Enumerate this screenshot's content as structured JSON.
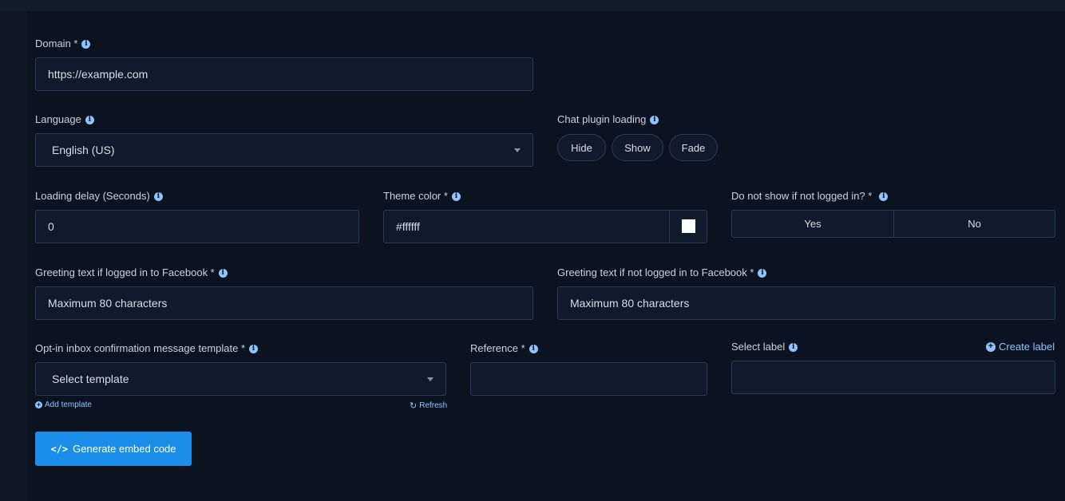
{
  "domain": {
    "label": "Domain *",
    "value": "https://example.com"
  },
  "language": {
    "label": "Language",
    "selected": "English (US)"
  },
  "chat_plugin": {
    "label": "Chat plugin loading",
    "options": [
      "Hide",
      "Show",
      "Fade"
    ]
  },
  "loading_delay": {
    "label": "Loading delay (Seconds)",
    "value": "0"
  },
  "theme_color": {
    "label": "Theme color *",
    "value": "#ffffff",
    "swatch_color": "#ffffff"
  },
  "not_logged": {
    "label": "Do not show if not logged in? *",
    "yes": "Yes",
    "no": "No"
  },
  "greeting_logged": {
    "label": "Greeting text if logged in to Facebook *",
    "placeholder": "Maximum 80 characters"
  },
  "greeting_not_logged": {
    "label": "Greeting text if not logged in to Facebook *",
    "placeholder": "Maximum 80 characters"
  },
  "optin": {
    "label": "Opt-in inbox confirmation message template *",
    "selected": "Select template",
    "add_template": "Add template",
    "refresh": "Refresh"
  },
  "reference": {
    "label": "Reference *",
    "value": ""
  },
  "select_label": {
    "label": "Select label",
    "create_label": "Create label",
    "value": ""
  },
  "generate_button": "Generate embed code",
  "colors": {
    "accent": "#1a8ee8",
    "link": "#8ec5ff",
    "panel_bg": "#0b1220",
    "field_bg": "#0f1a2c"
  }
}
